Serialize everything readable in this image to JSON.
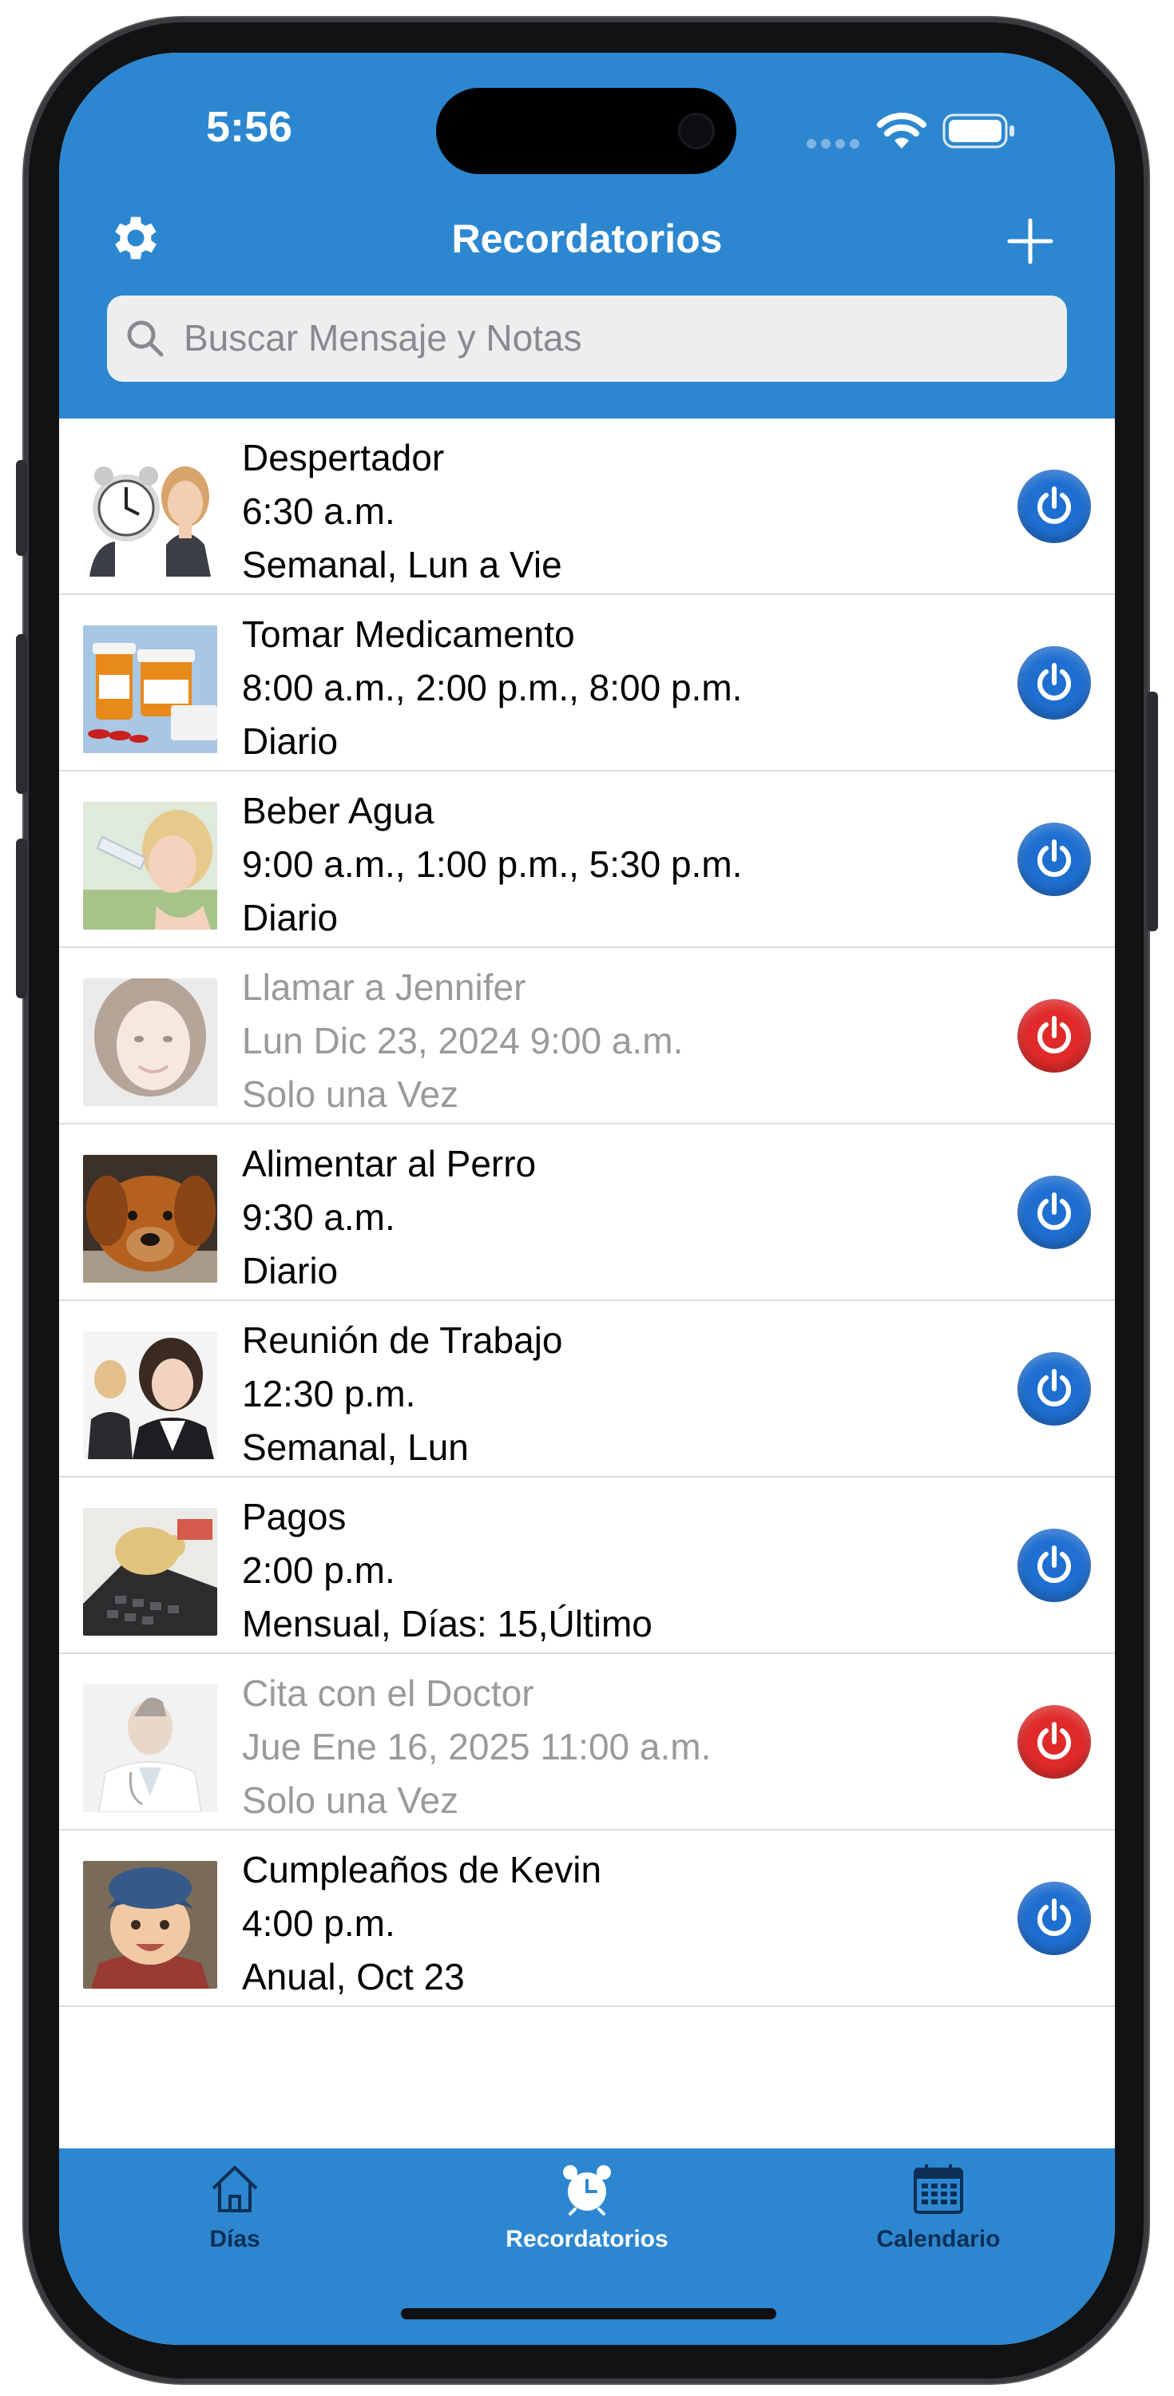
{
  "status_bar": {
    "time": "5:56"
  },
  "header": {
    "title": "Recordatorios",
    "settings_icon": "gear-icon",
    "add_icon": "plus-icon",
    "search_placeholder": "Buscar Mensaje y Notas"
  },
  "reminders": [
    {
      "title": "Despertador",
      "time": "6:30 a.m.",
      "repeat": "Semanal, Lun a Vie",
      "active": true,
      "thumb": "alarm-clock-woman-image"
    },
    {
      "title": "Tomar Medicamento",
      "time": "8:00 a.m., 2:00 p.m., 8:00 p.m.",
      "repeat": "Diario",
      "active": true,
      "thumb": "pill-bottles-image"
    },
    {
      "title": "Beber Agua",
      "time": "9:00 a.m., 1:00 p.m., 5:30 p.m.",
      "repeat": "Diario",
      "active": true,
      "thumb": "woman-drinking-water-image"
    },
    {
      "title": "Llamar a Jennifer",
      "time": "Lun Dic 23, 2024 9:00 a.m.",
      "repeat": "Solo una Vez",
      "active": false,
      "thumb": "smiling-woman-image"
    },
    {
      "title": "Alimentar al Perro",
      "time": "9:30 a.m.",
      "repeat": "Diario",
      "active": true,
      "thumb": "dog-image"
    },
    {
      "title": "Reunión de Trabajo",
      "time": "12:30 p.m.",
      "repeat": "Semanal, Lun",
      "active": true,
      "thumb": "business-team-image"
    },
    {
      "title": "Pagos",
      "time": "2:00 p.m.",
      "repeat": "Mensual, Días: 15,Último",
      "active": true,
      "thumb": "piggy-bank-calculator-image"
    },
    {
      "title": "Cita con el Doctor",
      "time": "Jue Ene 16, 2025 11:00 a.m.",
      "repeat": "Solo una Vez",
      "active": false,
      "thumb": "doctor-image"
    },
    {
      "title": "Cumpleaños de Kevin",
      "time": "4:00 p.m.",
      "repeat": "Anual, Oct 23",
      "active": true,
      "thumb": "baby-image"
    }
  ],
  "tabbar": {
    "tabs": [
      {
        "label": "Días",
        "icon": "house-icon",
        "selected": false
      },
      {
        "label": "Recordatorios",
        "icon": "alarm-clock-icon",
        "selected": true
      },
      {
        "label": "Calendario",
        "icon": "calendar-icon",
        "selected": false
      }
    ]
  },
  "colors": {
    "brand_blue": "#2c87d0",
    "active_power": "#1f6fd1",
    "inactive_power": "#e02a2a",
    "inactive_text": "#9a9a9a"
  }
}
